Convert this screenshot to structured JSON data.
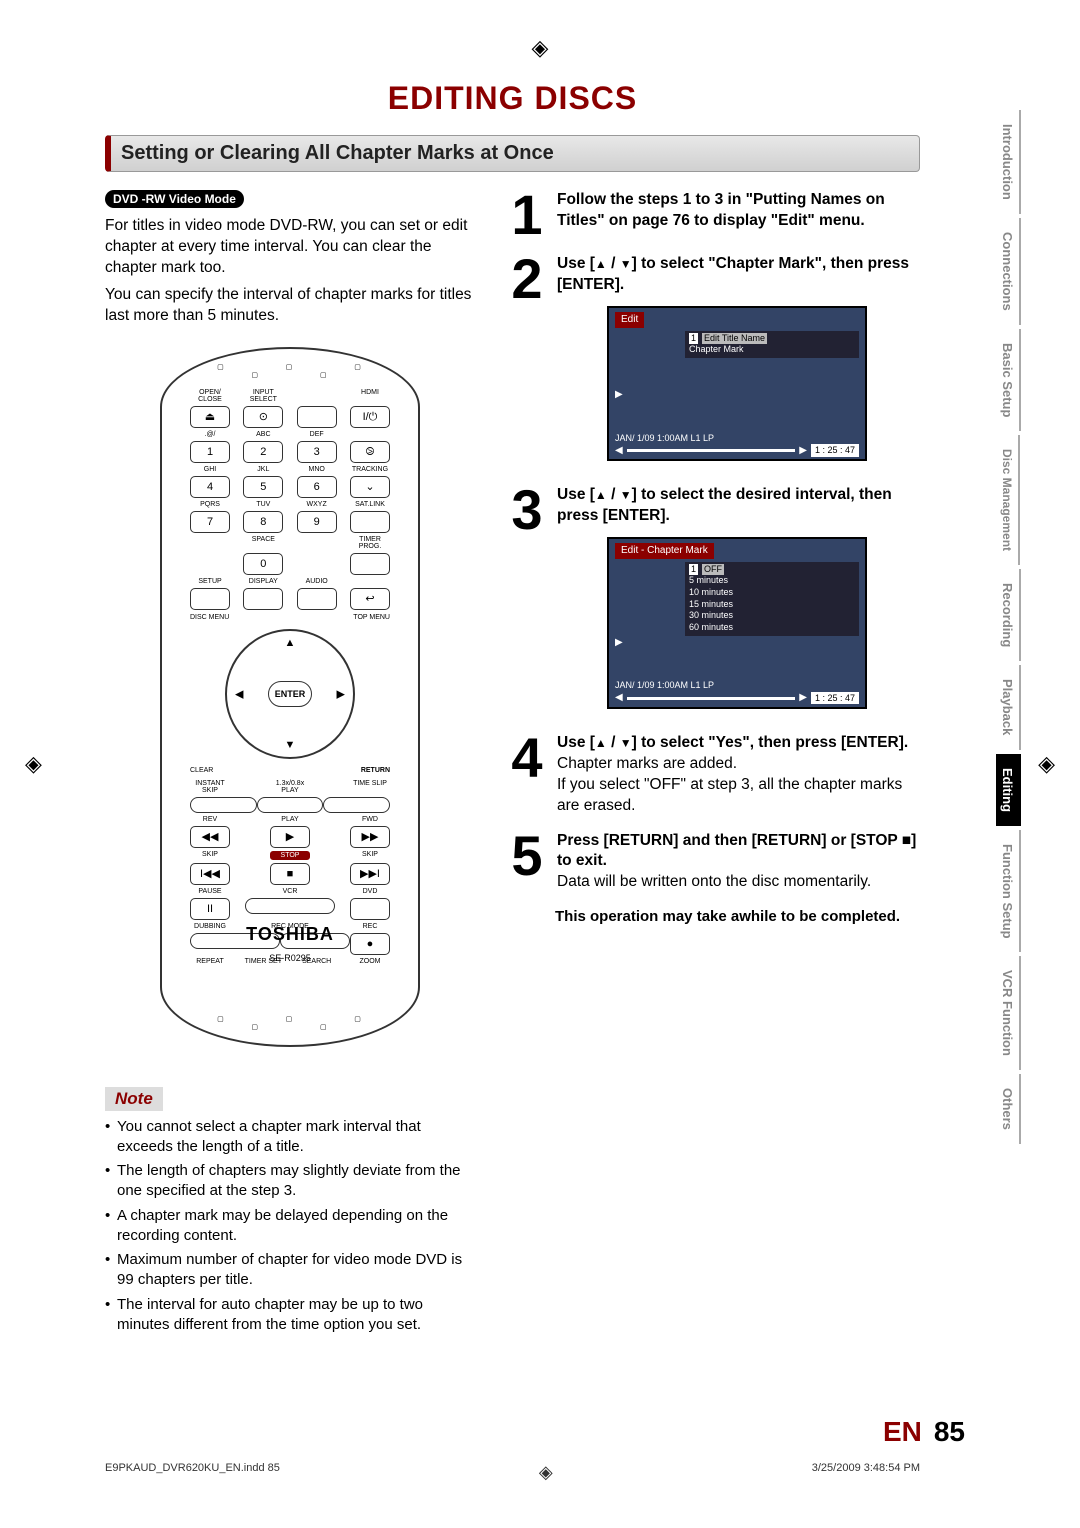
{
  "pageTitle": "EDITING DISCS",
  "sectionHeader": "Setting or Clearing All Chapter Marks at Once",
  "dvdBadge": "DVD -RW Video Mode",
  "intro1": "For titles in video mode DVD-RW, you can set or edit chapter at every time interval. You can clear the chapter mark too.",
  "intro2": "You can specify the interval of chapter marks for titles last more than 5 minutes.",
  "remote": {
    "brand": "TOSHIBA",
    "model": "SE-R0295",
    "row1": [
      "OPEN/\nCLOSE",
      "INPUT\nSELECT",
      "",
      "HDMI"
    ],
    "abc": [
      ".@/",
      "ABC",
      "DEF"
    ],
    "ghi": [
      "GHI",
      "JKL",
      "MNO",
      "TRACKING"
    ],
    "pqrs": [
      "PQRS",
      "TUV",
      "WXYZ",
      "SAT.LINK"
    ],
    "space": "SPACE",
    "timer": "TIMER\nPROG.",
    "setup": [
      "SETUP",
      "DISPLAY",
      "AUDIO"
    ],
    "discmenu": "DISC MENU",
    "topmenu": "TOP MENU",
    "enter": "ENTER",
    "clear": "CLEAR",
    "return": "RETURN",
    "instant": "INSTANT\nSKIP",
    "play13": "1.3x/0.8x\nPLAY",
    "timeslip": "TIME SLIP",
    "rev": "REV",
    "play": "PLAY",
    "fwd": "FWD",
    "skip": "SKIP",
    "stop": "STOP",
    "pause": "PAUSE",
    "vcr": "VCR",
    "dvd": "DVD",
    "dubbing": "DUBBING",
    "recmode": "REC MODE",
    "rec": "REC",
    "repeat": "REPEAT",
    "timerset": "TIMER SET",
    "search": "SEARCH",
    "zoom": "ZOOM"
  },
  "noteLabel": "Note",
  "notes": [
    "You cannot select a chapter mark interval that exceeds the length of a title.",
    "The length of chapters may slightly deviate from the one specified at the step 3.",
    "A chapter mark may be delayed depending on the recording content.",
    "Maximum number of chapter for video mode DVD is 99 chapters per title.",
    "The interval for auto chapter may be up to two minutes different from the time option you set."
  ],
  "steps": {
    "s1": "Follow the steps 1 to 3 in \"Putting Names on Titles\" on page 76 to display \"Edit\" menu.",
    "s2a": "Use [",
    "s2b": " / ",
    "s2c": "] to select \"Chapter Mark\", then press [ENTER].",
    "s3a": "Use [",
    "s3b": " / ",
    "s3c": "] to select the desired interval, then press [ENTER].",
    "s4a": "Use [",
    "s4b": " / ",
    "s4c": "] to select \"Yes\", then press [ENTER].",
    "s4body1": "Chapter marks are added.",
    "s4body2": "If you select \"OFF\" at step 3, all the chapter marks are erased.",
    "s5a": "Press [RETURN] and then [RETURN] or [STOP ",
    "s5b": "] to exit.",
    "s5body": "Data will be written onto the disc momentarily.",
    "finalNote": "This operation may take awhile to be completed."
  },
  "osd1": {
    "title": "Edit",
    "item1": "Edit Title Name",
    "item2": "Chapter Mark",
    "status": "JAN/ 1/09 1:00AM L1   LP",
    "time": "1 : 25 : 47"
  },
  "osd2": {
    "title": "Edit - Chapter Mark",
    "opts": [
      "OFF",
      "5 minutes",
      "10 minutes",
      "15 minutes",
      "30 minutes",
      "60 minutes"
    ],
    "status": "JAN/ 1/09 1:00AM L1   LP",
    "time": "1 : 25 : 47"
  },
  "tabs": [
    "Introduction",
    "Connections",
    "Basic Setup",
    "Disc Management",
    "Recording",
    "Playback",
    "Editing",
    "Function Setup",
    "VCR Function",
    "Others"
  ],
  "activeTab": "Editing",
  "pageNum": {
    "lang": "EN",
    "num": "85"
  },
  "footer": {
    "file": "E9PKAUD_DVR620KU_EN.indd   85",
    "stamp": "3/25/2009   3:48:54 PM"
  }
}
